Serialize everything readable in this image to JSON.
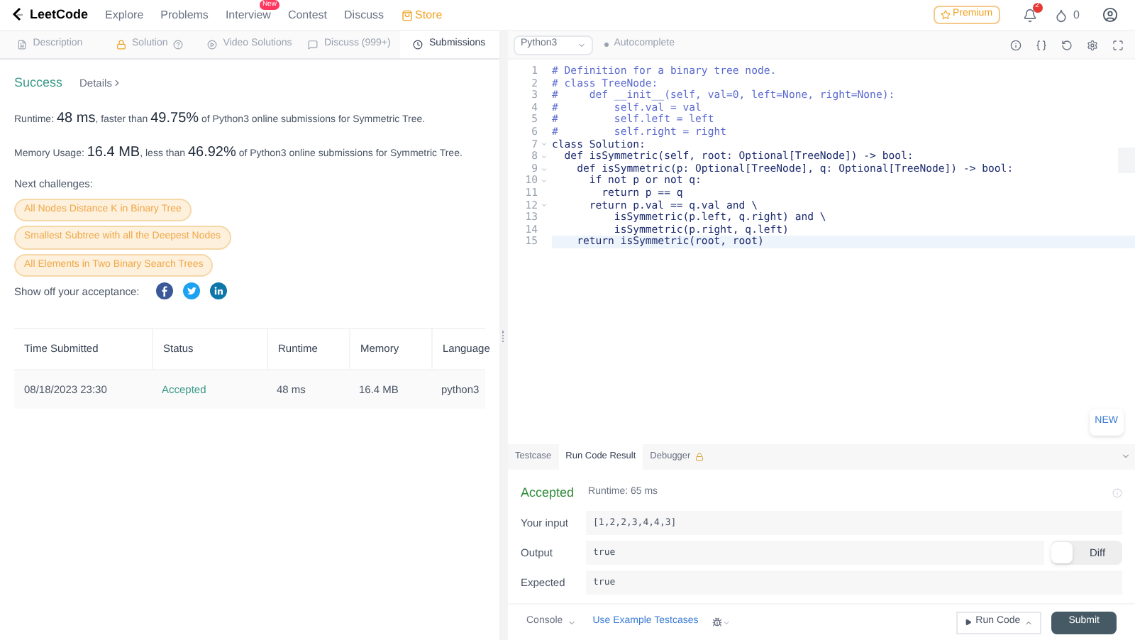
{
  "nav": {
    "logo": "LeetCode",
    "links": [
      {
        "label": "Explore",
        "kind": "plain"
      },
      {
        "label": "Problems",
        "kind": "plain"
      },
      {
        "label": "Interview",
        "kind": "badge",
        "badge": "New"
      },
      {
        "label": "Contest",
        "kind": "plain"
      },
      {
        "label": "Discuss",
        "kind": "plain"
      },
      {
        "label": "Store",
        "kind": "store"
      }
    ],
    "premium": "Premium",
    "notifications": "2",
    "coins": "0"
  },
  "tabs": [
    {
      "label": "Description",
      "kind": "doc",
      "selected": false
    },
    {
      "label": "Solution",
      "kind": "lock",
      "selected": false
    },
    {
      "label": "Video Solutions",
      "kind": "play",
      "selected": false
    },
    {
      "label": "Discuss (999+)",
      "kind": "chat",
      "selected": false
    },
    {
      "label": "Submissions",
      "kind": "clock",
      "selected": true
    }
  ],
  "result": {
    "status": "Success",
    "details": "Details",
    "runtime": "Runtime: **48 ms**, faster than **49.75%** of Python3 online submissions for Symmetric Tree.",
    "memory": "Memory Usage: **16.4 MB**, less than **46.92%** of Python3 online submissions for Symmetric Tree.",
    "next_label": "Next challenges:",
    "challenges": [
      "All Nodes Distance K in Binary Tree",
      "Smallest Subtree with all the Deepest Nodes",
      "All Elements in Two Binary Search Trees"
    ],
    "share_label": "Show off your acceptance:"
  },
  "table": {
    "columns": [
      "Time Submitted",
      "Status",
      "Runtime",
      "Memory",
      "Language"
    ],
    "rows": [
      [
        "08/18/2023 23:30",
        "Accepted",
        "48 ms",
        "16.4 MB",
        "python3"
      ]
    ]
  },
  "editor": {
    "language": "Python3",
    "autocomplete": "Autocomplete",
    "new_badge": "NEW",
    "lines": [
      {
        "num": "1",
        "text": "# Definition for a binary tree node.",
        "kind": "comment",
        "foldable": false,
        "active": false
      },
      {
        "num": "2",
        "text": "# class TreeNode:",
        "kind": "comment",
        "foldable": false,
        "active": false
      },
      {
        "num": "3",
        "text": "#     def __init__(self, val=0, left=None, right=None):",
        "kind": "comment",
        "foldable": false,
        "active": false
      },
      {
        "num": "4",
        "text": "#         self.val = val",
        "kind": "comment",
        "foldable": false,
        "active": false
      },
      {
        "num": "5",
        "text": "#         self.left = left",
        "kind": "comment",
        "foldable": false,
        "active": false
      },
      {
        "num": "6",
        "text": "#         self.right = right",
        "kind": "comment",
        "foldable": false,
        "active": false
      },
      {
        "num": "7",
        "text": "class Solution:",
        "kind": "code",
        "foldable": true,
        "active": false
      },
      {
        "num": "8",
        "text": "  def isSymmetric(self, root: Optional[TreeNode]) -> bool:",
        "kind": "code",
        "foldable": true,
        "active": false
      },
      {
        "num": "9",
        "text": "    def isSymmetric(p: Optional[TreeNode], q: Optional[TreeNode]) -> bool:",
        "kind": "code",
        "foldable": true,
        "active": false
      },
      {
        "num": "10",
        "text": "      if not p or not q:",
        "kind": "code",
        "foldable": true,
        "active": false
      },
      {
        "num": "11",
        "text": "        return p == q",
        "kind": "code",
        "foldable": false,
        "active": false
      },
      {
        "num": "12",
        "text": "      return p.val == q.val and \\",
        "kind": "code",
        "foldable": true,
        "active": false
      },
      {
        "num": "13",
        "text": "          isSymmetric(p.left, q.right) and \\",
        "kind": "code",
        "foldable": false,
        "active": false
      },
      {
        "num": "14",
        "text": "          isSymmetric(p.right, q.left)",
        "kind": "code",
        "foldable": false,
        "active": false
      },
      {
        "num": "15",
        "text": "    return isSymmetric(root, root)",
        "kind": "code",
        "foldable": false,
        "active": true
      }
    ]
  },
  "console": {
    "tabs": [
      {
        "label": "Testcase",
        "locked": false,
        "selected": false
      },
      {
        "label": "Run Code Result",
        "locked": false,
        "selected": true
      },
      {
        "label": "Debugger",
        "locked": true,
        "selected": false
      }
    ],
    "status": "Accepted",
    "runtime": "Runtime: 65 ms",
    "rows": [
      {
        "label": "Your input",
        "value": "[1,2,2,3,4,4,3]",
        "diff": false
      },
      {
        "label": "Output",
        "value": "true",
        "diff": true
      },
      {
        "label": "Expected",
        "value": "true",
        "diff": false
      }
    ],
    "diff_label": "Diff",
    "diff_on": false,
    "console_label": "Console",
    "example": "Use Example Testcases",
    "run": "Run Code",
    "submit": "Submit"
  }
}
